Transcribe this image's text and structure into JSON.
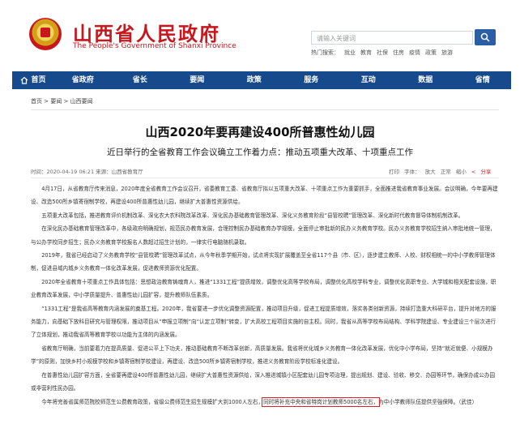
{
  "header": {
    "title": "山西省人民政府",
    "subtitle": "The People's Government of Shanxi Province",
    "search_placeholder": "请输入关键词",
    "hot_label": "热门搜索：",
    "hot_terms": [
      "就业",
      "教育",
      "社保",
      "住房",
      "疫情",
      "政策",
      "旅游"
    ]
  },
  "nav": {
    "items": [
      "首页",
      "省政府",
      "省长",
      "要闻",
      "政策",
      "服务",
      "互动",
      "数据",
      "省情"
    ]
  },
  "breadcrumb": "首页 > 要闻 > 山西要闻",
  "article": {
    "title": "山西2020年要再建设400所普惠性幼儿园",
    "subtitle": "近日举行的全省教育工作会议确立工作着力点：推动五项重大改革、十项重点工作",
    "meta": "时间：2020-04-19 06:21   来源：山西省教育厅",
    "tools": [
      "打印",
      "字体：",
      "放大",
      "正常",
      "缩小"
    ],
    "share": "分享",
    "paragraphs": [
      "4月17日，从省教育厅传来消息，2020年度全省教育工作会议召开，省委教育工委、省教育厅拟以五项重大改革、十项重点工作为重要抓手，全面推进我省教育事业发展。会议明确，今年要再建设、改造500所乡镇寄宿制学校，再建设400所普惠性幼儿园，继续扩大普惠性资源供给。",
      "五项重大改革包括，推进教育评价机制改革、深化农大农科院改革改革、深化民办基础教育管理改革、深化义务教育阶段“县管校聘”管理改革、深化新时代教育督导体制机制改革。",
      "在深化民办基础教育管理改革中，各级政府明确规划，规范民办教育发展，合理控制民办基础教育办学规模，全面停止审批新的民办义务教育学校。民办义务教育学校招生纳入审批地统一管理，与公办学校同步招生；民办义务教育学校报名人数超过招生计划的，一律实行电脑随机录取。",
      "2019年，我省已经启动了义务教育学校“县管校聘”管理改革试点，从今年秋季学期开始，试点将实现扩展覆盖至全省117个县（市、区），逐步建立教师、人校、财权相统一的中小学教师管理体制，促进县域内城乡义务教育一体化改革发展，促进教师资源优化配置。",
      "2020年全省教育十项重点工作具体包括：思想政治教育铸魂育人，推进“1331工程”提质增效，调整优化高等学校布局，调整优化高校学科专业，调整优化高职专业、大学城和相关配套设施，职业教育改革发展，中小学质量提升、普惠性幼儿园扩容，提升教师队伍素质。",
      "“1331工程”是我省高等教育内涵发展的奠基工程。2020年，我省要进一步优化调整资源配置，推动项目升级，促进工程提质增效，落实各类创新资源，持续打造重大科研平台，提升对地方的服务能力，向基础下放科目研究与管理权限，推动项目从“申报立项制”向“认定立项制”转变，扩大高校工程项目实施的自主权。同时，我省从高等学校布局结构、学科学院建设、专业建设三个层次进行了立体规划，推动我省高等教育学校以功能为主体的内涵发展。",
      "省教育厅明确，当前要着力在提高质量、促进公平上下功夫，推动基础教育不断改革创新，高质量发展。我省将优化城乡义务教育一体化改革发展，优化中小学布局，坚持“就近就便、小规模办学”的原则，加快乡村小规模学校和乡镇寄宿制学校建设，再建设、改造500所乡镇寄宿制学校，推进义务教育阶段学校标准化建设。",
      "在普惠性幼儿园扩容方面，全省要再建设400所普惠性幼儿园，继续扩大普惠性资源供给，深入推进城镇小区配套幼儿园专项治理，提出规划、建设、验收、移交、办园等环节，确保办成公办园或非营利性民办园。",
      "今年将完善省属师范院校师范生公费教育政策，省级公费师范生招生规模扩大到1000人左右，同时将补充中央和省特岗计划教师5000名左右，为中小学教师队伍提供坚强保障。（武佳）"
    ],
    "last_paragraph_parts": {
      "before": "今年将完善省属师范院校师范生公费教育政策，省级公费师范生招生规模扩大到1000人左右，",
      "highlight": "同时将补充中央和省特岗计划教师5000名左右，",
      "after": "为中小学教师队伍提供坚强保障。（武佳）"
    }
  }
}
